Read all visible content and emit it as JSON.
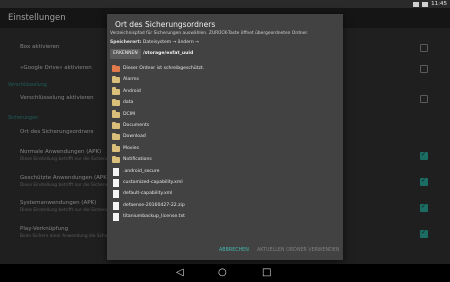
{
  "status_bar": {
    "time": "11:45"
  },
  "action_bar": {
    "title": "Einstellungen"
  },
  "settings": {
    "rows": [
      {
        "title": "Box aktivieren",
        "checked": false
      },
      {
        "title": "»Google Drive« aktivieren",
        "checked": false
      },
      {
        "category": "Verschlüsselung"
      },
      {
        "title": "Verschlüsselung aktivieren",
        "checked": false
      },
      {
        "category": "Sicherungen"
      },
      {
        "title": "Ort des Sicherungsordners"
      },
      {
        "title": "Normale Anwendungen (APK)",
        "summary": "Diese Einstellung betrifft nur die Sicherungen",
        "checked": true
      },
      {
        "title": "Geschützte Anwendungen (APK)",
        "summary": "Diese Einstellung betrifft nur die Sicherungen",
        "checked": true
      },
      {
        "title": "Systemanwendungen (APK)",
        "summary": "Diese Einstellung betrifft nur die Sicherungen",
        "checked": true
      },
      {
        "title": "Play-Verknüpfung",
        "summary": "Beim Sichern einer Anwendung die Scho",
        "checked": true
      }
    ]
  },
  "dialog": {
    "title": "Ort des Sicherungsordners",
    "subtitle": "Verzeichnispfad für Sicherungen auswählen. ZURÜCK-Taste öffnet übergeordneten Ordner.",
    "location_label": "Speicherort:",
    "location_value": "Dateisystem → ändern →",
    "detect_button": "ERKENNEN",
    "current_path": "/storage/exfat_uuid",
    "items": [
      {
        "type": "warn",
        "name": "Dieser Ordner ist schreibgeschützt."
      },
      {
        "type": "folder",
        "name": "Alarms"
      },
      {
        "type": "folder",
        "name": "Android"
      },
      {
        "type": "folder",
        "name": "data"
      },
      {
        "type": "folder",
        "name": "DCIM"
      },
      {
        "type": "folder",
        "name": "Documents"
      },
      {
        "type": "folder",
        "name": "Download"
      },
      {
        "type": "folder",
        "name": "Movies"
      },
      {
        "type": "folder",
        "name": "Notifications"
      },
      {
        "type": "file",
        "name": ".android_secure"
      },
      {
        "type": "file",
        "name": "customized-capability.xml"
      },
      {
        "type": "file",
        "name": "default-capability.xml"
      },
      {
        "type": "file",
        "name": "defaense-20160427-22.zip"
      },
      {
        "type": "file",
        "name": "titaniumbackup_license.txt"
      }
    ],
    "cancel_button": "ABBRECHEN",
    "use_button": "AKTUELLEN ORDNER VERWENDEN"
  },
  "colors": {
    "accent": "#2aa89a",
    "dialog_bg": "#424242",
    "folder": "#d9bf7a",
    "warning_folder": "#e07a4a"
  },
  "icons": {
    "back": "back-triangle-icon",
    "home": "home-circle-icon",
    "recents": "recents-square-icon"
  }
}
